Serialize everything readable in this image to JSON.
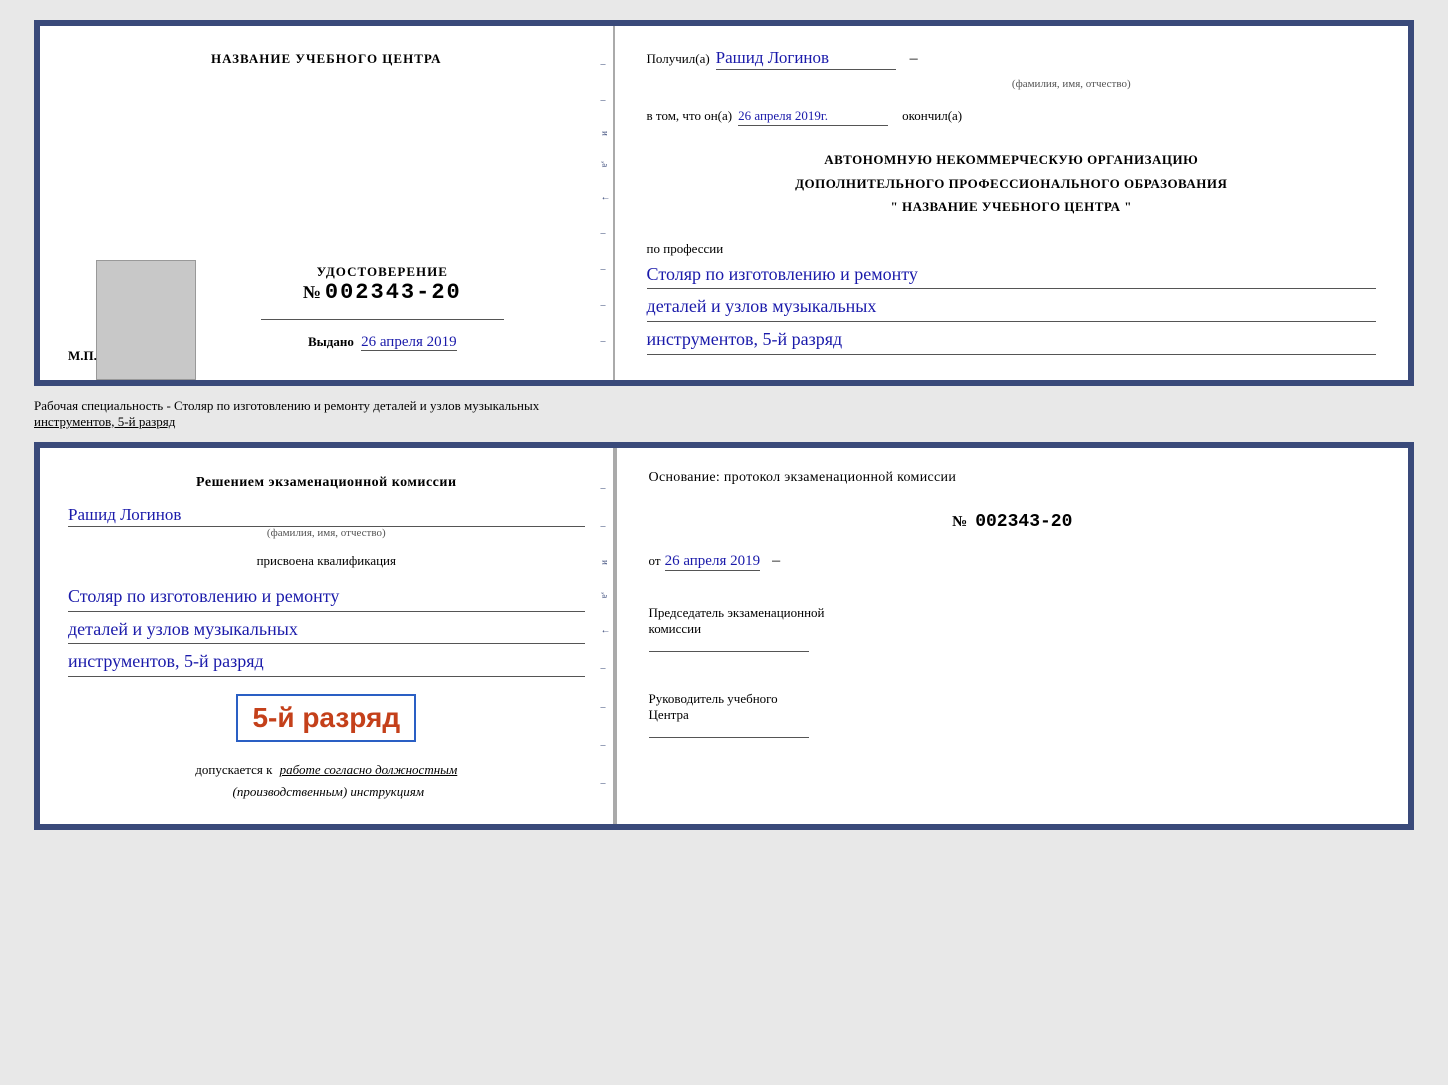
{
  "page": {
    "background_color": "#e8e8e8"
  },
  "top_certificate": {
    "left": {
      "title": "НАЗВАНИЕ УЧЕБНОГО ЦЕНТРА",
      "cert_label": "УДОСТОВЕРЕНИЕ",
      "cert_number_prefix": "№",
      "cert_number": "002343-20",
      "issued_label": "Выдано",
      "issued_date": "26 апреля 2019",
      "stamp_label": "М.П."
    },
    "right": {
      "received_label": "Получил(а)",
      "fio_value": "Рашид Логинов",
      "fio_hint": "(фамилия, имя, отчество)",
      "separator": "–",
      "in_that_label": "в том, что он(а)",
      "in_that_date": "26 апреля 2019г.",
      "finished_label": "окончил(а)",
      "org_line1": "АВТОНОМНУЮ НЕКОММЕРЧЕСКУЮ ОРГАНИЗАЦИЮ",
      "org_line2": "ДОПОЛНИТЕЛЬНОГО ПРОФЕССИОНАЛЬНОГО ОБРАЗОВАНИЯ",
      "org_line3": "\"  НАЗВАНИЕ УЧЕБНОГО ЦЕНТРА  \"",
      "profession_label": "по профессии",
      "profession_line1": "Столяр по изготовлению и ремонту",
      "profession_line2": "деталей и узлов музыкальных",
      "profession_line3": "инструментов, 5-й разряд"
    }
  },
  "between_label": {
    "text": "Рабочая специальность - Столяр по изготовлению и ремонту деталей и узлов музыкальных",
    "text2": "инструментов, 5-й разряд"
  },
  "bottom_certificate": {
    "left": {
      "commission_line1": "Решением экзаменационной комиссии",
      "fio_value": "Рашид Логинов",
      "fio_hint": "(фамилия, имя, отчество)",
      "assigned_label": "присвоена квалификация",
      "profession_line1": "Столяр по изготовлению и ремонту",
      "profession_line2": "деталей и узлов музыкальных",
      "profession_line3": "инструментов, 5-й разряд",
      "rank_text": "5-й разряд",
      "allowed_label": "допускается к",
      "allowed_value": "работе согласно должностным",
      "allowed_value2": "(производственным) инструкциям"
    },
    "right": {
      "basis_label": "Основание: протокол экзаменационной комиссии",
      "number_prefix": "№",
      "number_value": "002343-20",
      "date_prefix": "от",
      "date_value": "26 апреля 2019",
      "chairman_label": "Председатель экзаменационной",
      "chairman_label2": "комиссии",
      "director_label": "Руководитель учебного",
      "director_label2": "Центра"
    }
  }
}
